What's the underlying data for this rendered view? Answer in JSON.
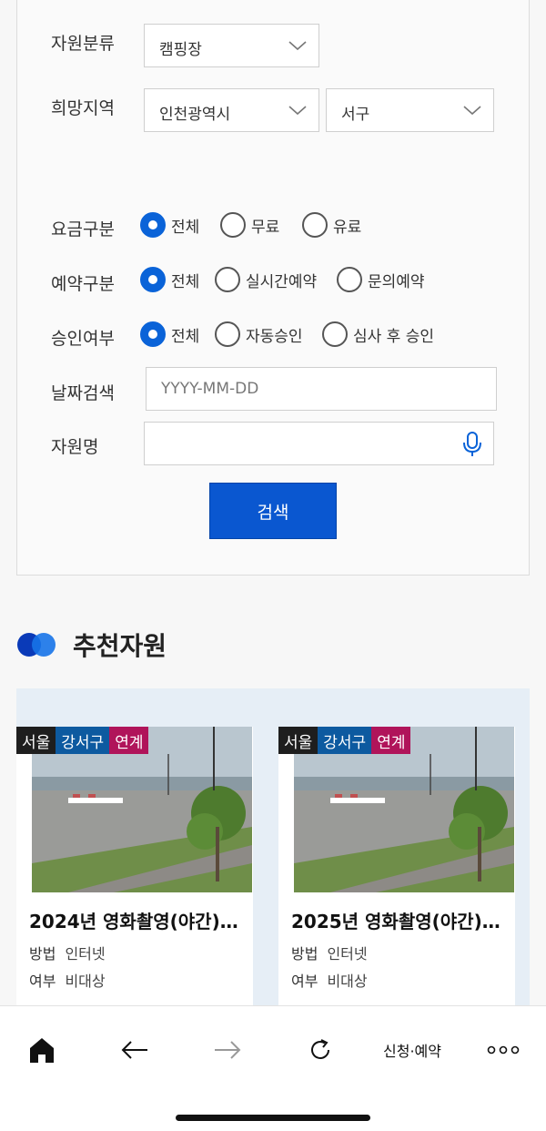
{
  "search": {
    "resource_type": {
      "label": "자원분류",
      "value": "캠핑장"
    },
    "region": {
      "label": "희망지역",
      "city": "인천광역시",
      "district": "서구"
    },
    "fee": {
      "label": "요금구분",
      "options": [
        "전체",
        "무료",
        "유료"
      ],
      "selected": 0
    },
    "reservation": {
      "label": "예약구분",
      "options": [
        "전체",
        "실시간예약",
        "문의예약"
      ],
      "selected": 0
    },
    "approval": {
      "label": "승인여부",
      "options": [
        "전체",
        "자동승인",
        "심사 후 승인"
      ],
      "selected": 0
    },
    "date": {
      "label": "날짜검색",
      "placeholder": "YYYY-MM-DD",
      "value": ""
    },
    "name": {
      "label": "자원명",
      "placeholder": "",
      "value": ""
    },
    "button_label": "검색"
  },
  "recommended": {
    "title": "추천자원",
    "cards": [
      {
        "tags": [
          "서울",
          "강서구",
          "연계"
        ],
        "title": "2024년 영화촬영(야간)-…",
        "rows": [
          {
            "k": "방법",
            "v": "인터넷"
          },
          {
            "k": "여부",
            "v": "비대상"
          }
        ]
      },
      {
        "tags": [
          "서울",
          "강서구",
          "연계"
        ],
        "title": "2025년 영화촬영(야간)-…",
        "rows": [
          {
            "k": "방법",
            "v": "인터넷"
          },
          {
            "k": "여부",
            "v": "비대상"
          }
        ]
      }
    ]
  },
  "bottom_nav": {
    "items": [
      "home-icon",
      "back-icon",
      "forward-icon",
      "reload-icon",
      "신청·예약",
      "more-icon"
    ]
  },
  "colors": {
    "accent": "#0a63d8",
    "button": "#0a57d0",
    "tag_dark": "#1e1e1e",
    "tag_blue": "#0d5aa0",
    "tag_magenta": "#b0145a"
  }
}
